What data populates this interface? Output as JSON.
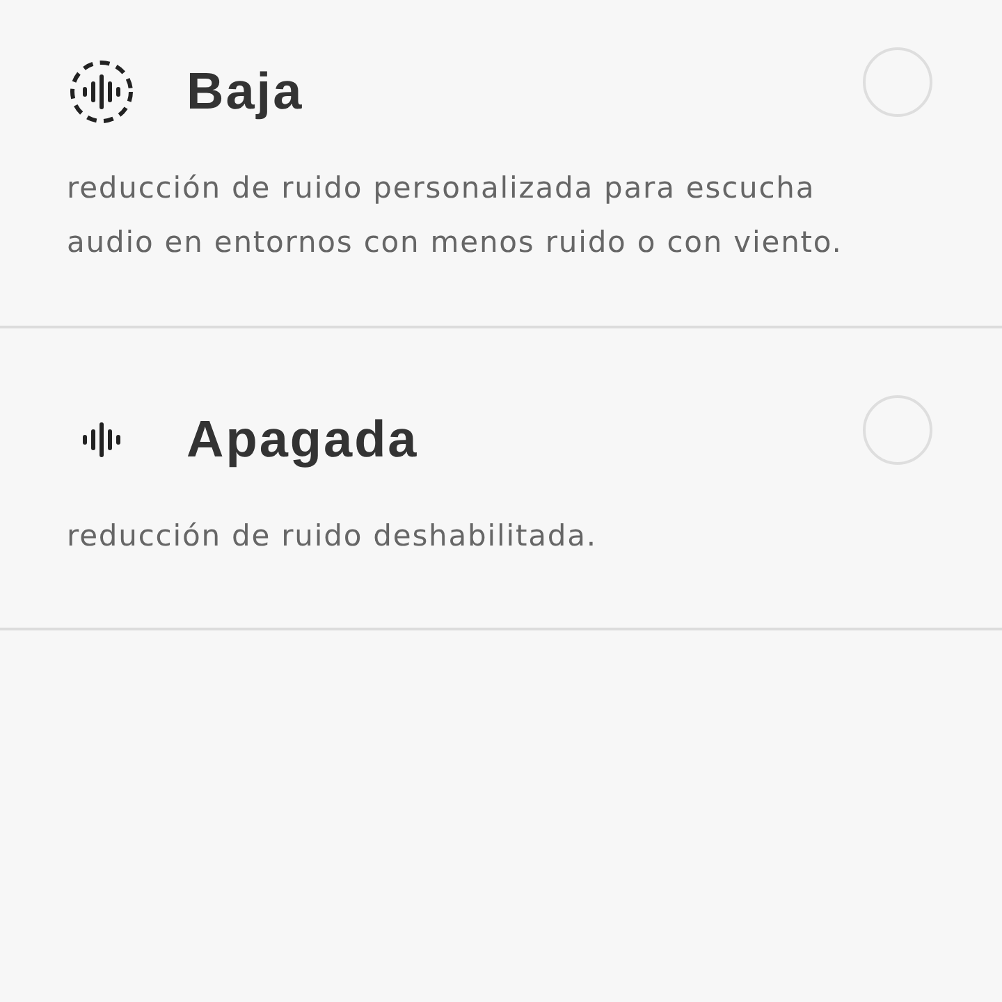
{
  "options": [
    {
      "kind": "low",
      "title": "Baja",
      "description": "reducción de ruido personalizada para escucha audio en entornos con menos ruido o con viento.",
      "selected": false
    },
    {
      "kind": "off",
      "title": "Apagada",
      "description": "reducción de ruido deshabilitada.",
      "selected": false
    }
  ]
}
